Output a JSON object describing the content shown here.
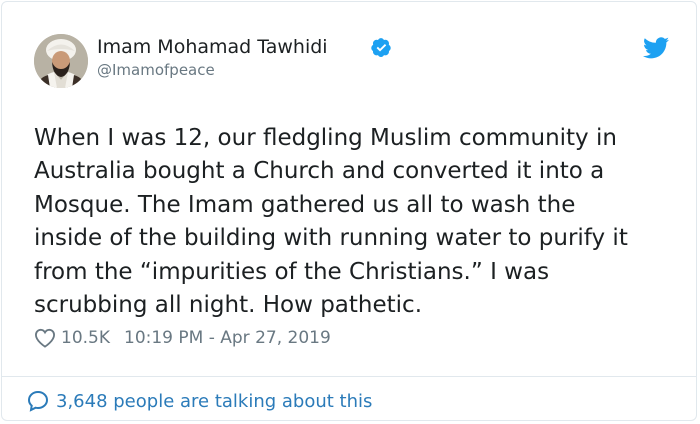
{
  "author": {
    "name": "Imam Mohamad Tawhidi",
    "handle": "@Imamofpeace",
    "verified": true
  },
  "tweet": {
    "lines": [
      "When I was 12, our fledgling Muslim community in",
      "Australia bought a Church and converted it into a",
      "Mosque. The Imam gathered us all to wash the",
      "inside of the building with running water to purify it",
      "from the “impurities of the Christians.” I was",
      "scrubbing all night. How pathetic."
    ]
  },
  "meta": {
    "likes": "10.5K",
    "timestamp": "10:19 PM - Apr 27, 2019"
  },
  "footer": {
    "talking": "3,648 people are talking about this"
  },
  "icons": {
    "verified": "verified-badge-icon",
    "bird": "twitter-bird-icon",
    "like": "heart-icon",
    "reply": "speech-bubble-icon"
  },
  "colors": {
    "accent": "#1da1f2",
    "link": "#2b7bb9",
    "text": "#1c2022",
    "muted": "#697882",
    "border": "#e1e8ed"
  }
}
